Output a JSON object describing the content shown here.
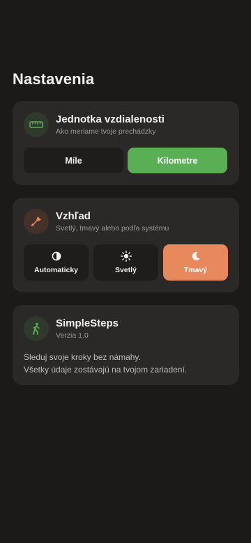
{
  "page": {
    "title": "Nastavenia"
  },
  "distance": {
    "title": "Jednotka vzdialenosti",
    "subtitle": "Ako meriame tvoje prechádzky",
    "icon": "ruler-icon",
    "options": [
      {
        "label": "Míle",
        "selected": false
      },
      {
        "label": "Kilometre",
        "selected": true
      }
    ],
    "accent": "#5aaf55"
  },
  "appearance": {
    "title": "Vzhľad",
    "subtitle": "Svetlý, tmavý alebo podľa systému",
    "icon": "paint-brush-icon",
    "options": [
      {
        "label": "Automaticky",
        "icon": "half-circle-icon",
        "selected": false
      },
      {
        "label": "Svetlý",
        "icon": "sun-icon",
        "selected": false
      },
      {
        "label": "Tmavý",
        "icon": "moon-icon",
        "selected": true
      }
    ],
    "accent": "#e8895d"
  },
  "about": {
    "title": "SimpleSteps",
    "version": "Verzia 1.0",
    "icon": "walking-person-icon",
    "line1": "Sleduj svoje kroky bez námahy.",
    "line2": "Všetky údaje zostávajú na tvojom zariadení."
  }
}
